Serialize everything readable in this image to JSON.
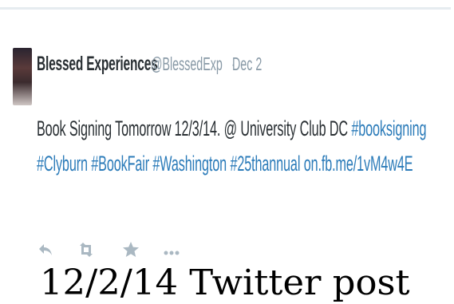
{
  "tweet": {
    "author_name": "Blessed Experiences",
    "handle": "@BlessedExp",
    "separator": "·",
    "date": "Dec 2",
    "text_part1": "Book Signing Tomorrow 12/3/14. @ University Club DC ",
    "hashtag_booksigning": "#booksigning",
    "hashtag_clyburn": "#Clyburn",
    "hashtag_bookfair": "#BookFair",
    "hashtag_washington": "#Washington",
    "hashtag_25thannual": "#25thannual",
    "link_url": "on.fb.me/1vM4w4E"
  },
  "actions": [
    {
      "icon": "reply-icon"
    },
    {
      "icon": "retweet-icon"
    },
    {
      "icon": "favorite-star-icon"
    },
    {
      "icon": "more-options-icon"
    }
  ],
  "caption": "12/2/14 Twitter post",
  "colors": {
    "text": "#292f33",
    "muted": "#8899a6",
    "link": "#2b7bb9",
    "action_icon": "#aab8c2"
  }
}
